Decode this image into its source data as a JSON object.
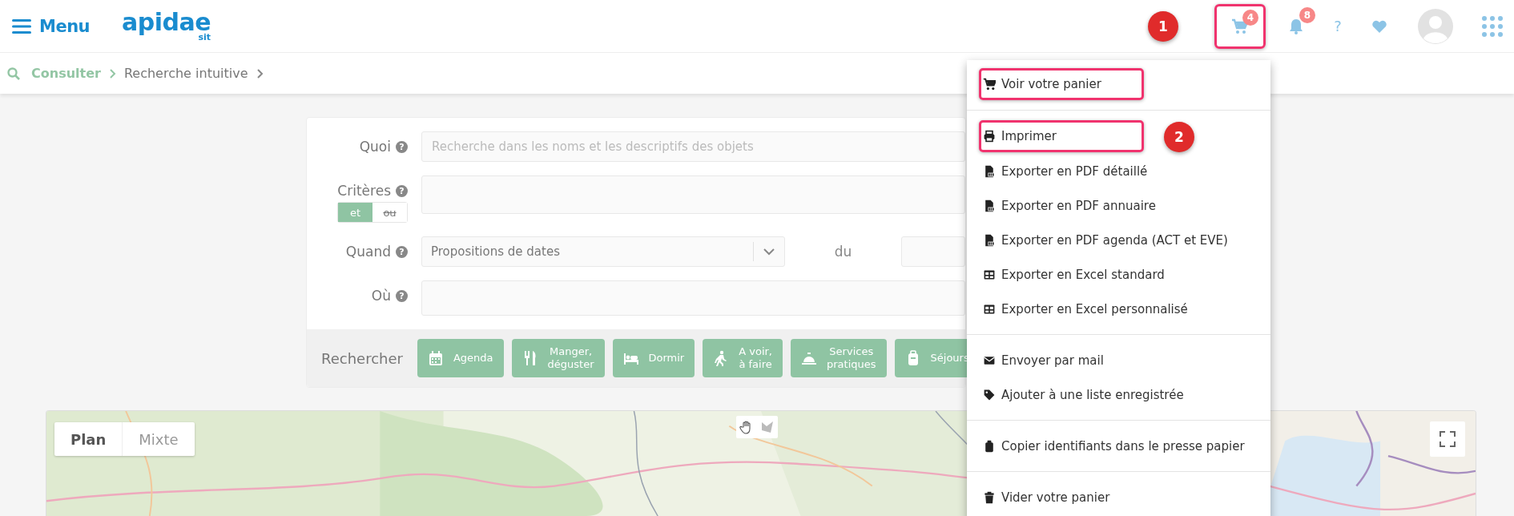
{
  "header": {
    "menu_label": "Menu",
    "logo": {
      "name": "apidae",
      "sub": "sit"
    },
    "cart": {
      "badge": "4",
      "highlighted": true
    },
    "notifications": {
      "badge": "8"
    },
    "help": "?"
  },
  "callouts": [
    "1",
    "2"
  ],
  "breadcrumb": [
    {
      "label": "Consulter",
      "kind": "link"
    },
    {
      "label": "Recherche intuitive",
      "kind": "current"
    }
  ],
  "form": {
    "fields": [
      {
        "label": "Quoi",
        "help": "?",
        "kind": "text",
        "placeholder": "Recherche dans les noms et les descriptifs des objets"
      },
      {
        "label": "Critères",
        "help": "?",
        "kind": "criteria",
        "toggle": [
          {
            "label": "et",
            "selected": true
          },
          {
            "label": "ou",
            "selected": false
          }
        ]
      },
      {
        "label": "Quand",
        "help": "?",
        "kind": "select",
        "value": "Propositions de dates",
        "range_label": "du"
      },
      {
        "label": "Où",
        "help": "?",
        "kind": "text"
      }
    ],
    "search_label": "Rechercher",
    "categories": [
      {
        "label": "Agenda",
        "kind": "calendar"
      },
      {
        "label": "Manger,\ndéguster",
        "kind": "utensils"
      },
      {
        "label": "Dormir",
        "kind": "bed"
      },
      {
        "label": "A voir,\nà faire",
        "kind": "walk"
      },
      {
        "label": "Services\npratiques",
        "kind": "service"
      },
      {
        "label": "Séjours",
        "kind": "suitcase"
      }
    ]
  },
  "cart_menu": {
    "groups": [
      [
        {
          "label": "Voir votre panier",
          "kind": "cart",
          "highlighted": true
        }
      ],
      [
        {
          "label": "Imprimer",
          "kind": "print",
          "highlighted": true
        },
        {
          "label": "Exporter en PDF détaillé",
          "kind": "pdf",
          "highlighted": false
        },
        {
          "label": "Exporter en PDF annuaire",
          "kind": "pdf",
          "highlighted": false
        },
        {
          "label": "Exporter en PDF agenda (ACT et EVE)",
          "kind": "pdf",
          "highlighted": false
        },
        {
          "label": "Exporter en Excel standard",
          "kind": "table",
          "highlighted": false
        },
        {
          "label": "Exporter en Excel personnalisé",
          "kind": "table",
          "highlighted": false
        }
      ],
      [
        {
          "label": "Envoyer par mail",
          "kind": "mail",
          "highlighted": false
        },
        {
          "label": "Ajouter à une liste enregistrée",
          "kind": "tag",
          "highlighted": false
        }
      ],
      [
        {
          "label": "Copier identifiants dans le presse papier",
          "kind": "clipboard",
          "highlighted": false
        }
      ],
      [
        {
          "label": "Vider votre panier",
          "kind": "trash",
          "highlighted": false
        }
      ]
    ]
  },
  "map": {
    "layers": [
      {
        "label": "Plan",
        "selected": true
      },
      {
        "label": "Mixte",
        "selected": false
      }
    ]
  }
}
